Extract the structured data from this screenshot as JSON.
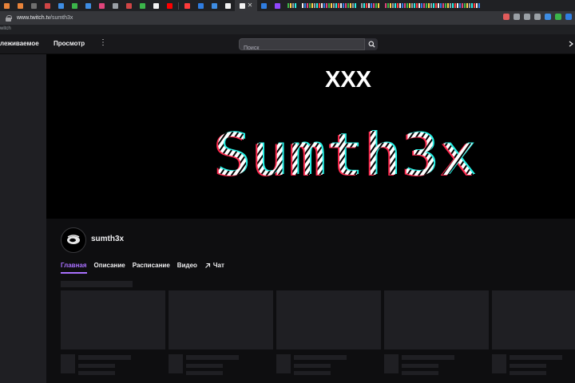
{
  "browser": {
    "url_domain": "www.twitch.tv",
    "url_path": "/sumth3x",
    "bookmark_text": "witch",
    "active_tab_close": "✕",
    "colors": {
      "tab_bar": "#202124",
      "address_bar": "#35363a",
      "favicons": [
        "#e8833a",
        "#e8833a",
        "#6f6f6f",
        "#d04545",
        "#3e8de3",
        "#3bb54a",
        "#3e8de3",
        "#e0457b",
        "#9aa0a6",
        "#d04545",
        "#3bb54a",
        "#f2f2f2",
        "#ff0000",
        "#ff3b3b",
        "#2f7de1",
        "#3e8de3",
        "#f2f2f2",
        "#f2f2f2",
        "#2f7de1",
        "#9147ff"
      ],
      "extensions": [
        "#e15b5b",
        "#9aa0a6",
        "#9aa0a6",
        "#9aa0a6",
        "#3e8de3",
        "#3bb54a",
        "#2f7de1"
      ]
    }
  },
  "nav": {
    "following": "леживаемое",
    "browse": "Просмотр",
    "more": "⋮",
    "search_placeholder": "Поиск"
  },
  "banner": {
    "line1": "XXX",
    "line2": "Sumth3x"
  },
  "channel": {
    "name": "sumth3x"
  },
  "tabs": [
    {
      "label": "Главная",
      "active": true
    },
    {
      "label": "Описание",
      "active": false
    },
    {
      "label": "Расписание",
      "active": false
    },
    {
      "label": "Видео",
      "active": false
    },
    {
      "label": "Чат",
      "active": false,
      "icon": "external-arrow-icon"
    }
  ],
  "colors": {
    "accent": "#a970ff",
    "page_bg": "#0e0e10",
    "nav_bg": "#18181b",
    "skeleton": "#1f1f23"
  }
}
